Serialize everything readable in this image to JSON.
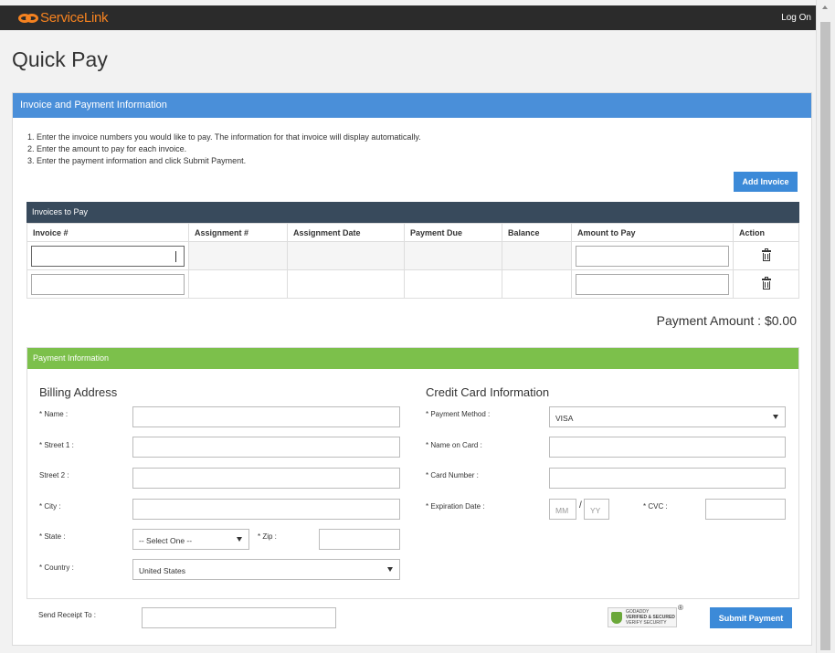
{
  "header": {
    "logo_text": "ServiceLink",
    "logon_label": "Log On",
    "brand_color": "#f58220"
  },
  "page": {
    "title": "Quick Pay"
  },
  "invoice_section": {
    "header": "Invoice and Payment Information",
    "instructions": [
      "1. Enter the invoice numbers you would like to pay. The information for that invoice will display automatically.",
      "2. Enter the amount to pay for each invoice.",
      "3. Enter the payment information and click Submit Payment."
    ],
    "add_invoice_label": "Add Invoice",
    "table_title": "Invoices to Pay",
    "columns": [
      "Invoice #",
      "Assignment #",
      "Assignment Date",
      "Payment Due",
      "Balance",
      "Amount to Pay",
      "Action"
    ],
    "rows": [
      {
        "invoice": "",
        "assignment": "",
        "assignment_date": "",
        "payment_due": "",
        "balance": "",
        "amount": "",
        "action_icon": "trash-icon"
      },
      {
        "invoice": "",
        "assignment": "",
        "assignment_date": "",
        "payment_due": "",
        "balance": "",
        "amount": "",
        "action_icon": "trash-icon"
      }
    ],
    "payment_amount_label": "Payment Amount : $0.00"
  },
  "payment": {
    "header": "Payment Information",
    "billing": {
      "title": "Billing Address",
      "name_label": "* Name :",
      "street1_label": "* Street 1 :",
      "street2_label": "Street 2 :",
      "city_label": "* City :",
      "state_label": "* State :",
      "state_value": "-- Select One --",
      "zip_label": "* Zip :",
      "country_label": "* Country :",
      "country_value": "United States"
    },
    "card": {
      "title": "Credit Card Information",
      "method_label": "* Payment Method :",
      "method_value": "VISA",
      "name_label": "* Name on Card :",
      "number_label": "* Card Number :",
      "exp_label": "* Expiration Date :",
      "exp_month_placeholder": "MM",
      "exp_sep": "/",
      "exp_year_placeholder": "YY",
      "cvc_label": "* CVC :"
    }
  },
  "footer": {
    "receipt_label": "Send Receipt To :",
    "seal_line1": "GODADDY",
    "seal_line2": "VERIFIED & SECURED",
    "seal_line3": "VERIFY SECURITY",
    "reg_mark": "®",
    "submit_label": "Submit Payment"
  },
  "colors": {
    "header_blue": "#4a8fd9",
    "table_header": "#384a5c",
    "payment_green": "#7cc04b",
    "button_blue": "#3c8ad8"
  }
}
